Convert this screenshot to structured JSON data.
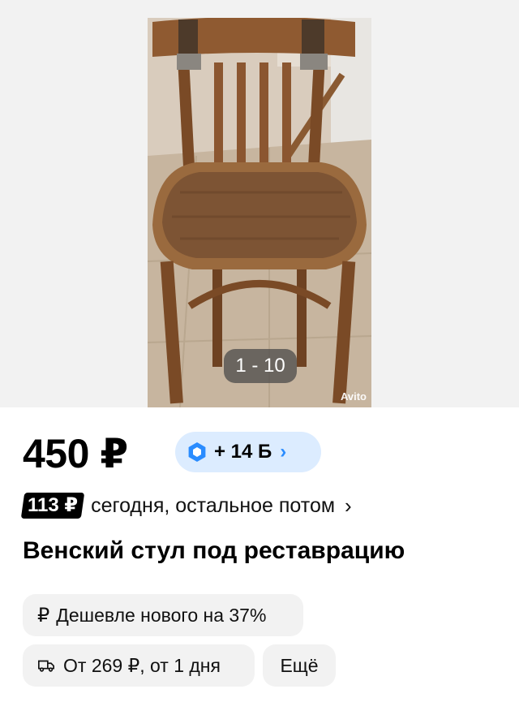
{
  "gallery": {
    "counter": "1 - 10",
    "watermark": "Avito",
    "photo_subject": "wooden chair"
  },
  "price": {
    "value": "450 ₽"
  },
  "bonus": {
    "label": "+ 14 Б",
    "icon": "bonus-hexagon-icon",
    "color": "#dcecff",
    "accent": "#2a8cff"
  },
  "installment": {
    "amount": "113 ₽",
    "text": "сегодня, остальное потом",
    "chevron": "›"
  },
  "title": "Венский стул под реставрацию",
  "chips": {
    "cheaper": {
      "icon": "ruble-icon",
      "icon_glyph": "₽",
      "label": "Дешевле нового на 37%"
    },
    "delivery": {
      "icon": "truck-icon",
      "label": "От 269 ₽, от 1 дня"
    },
    "more": {
      "label": "Ещё"
    }
  }
}
